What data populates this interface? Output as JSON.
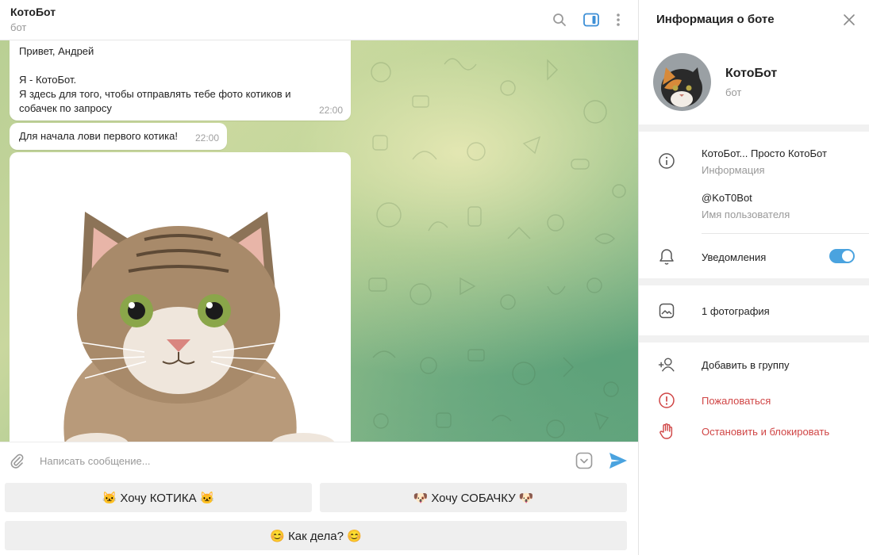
{
  "header": {
    "title": "КотоБот",
    "subtitle": "бот"
  },
  "messages": {
    "greeting": "Привет, Андрей",
    "intro_line1": "Я - КотоБот.",
    "intro_line2": "Я здесь для того, чтобы отправлять тебе фото котиков и",
    "intro_line3": "собачек по запросу",
    "time1": "22:00",
    "first_cat": "Для начала лови первого котика!",
    "time2": "22:00"
  },
  "composer": {
    "placeholder": "Написать сообщение..."
  },
  "keyboard": {
    "cat_button": "🐱 Хочу КОТИКА 🐱",
    "dog_button": "🐶 Хочу СОБАЧКУ 🐶",
    "how_button": "😊 Как дела? 😊"
  },
  "panel": {
    "title": "Информация о боте",
    "bot_name": "КотоБот",
    "bot_sub": "бот",
    "info_text": "КотоБот... Просто КотоБот",
    "info_label": "Информация",
    "username": "@KoT0Bot",
    "username_label": "Имя пользователя",
    "notifications": "Уведомления",
    "photos": "1 фотография",
    "add_to_group": "Добавить в группу",
    "report": "Пожаловаться",
    "block": "Остановить и блокировать"
  },
  "colors": {
    "accent": "#4aa3df",
    "danger": "#d04545",
    "keyboard_button": "#efefef"
  },
  "icons": [
    "search-icon",
    "sidebar-toggle-icon",
    "more-vertical-icon",
    "attach-icon",
    "bot-commands-icon",
    "send-icon",
    "close-icon",
    "info-icon",
    "bell-icon",
    "photo-icon",
    "add-user-icon",
    "report-icon",
    "block-hand-icon"
  ]
}
